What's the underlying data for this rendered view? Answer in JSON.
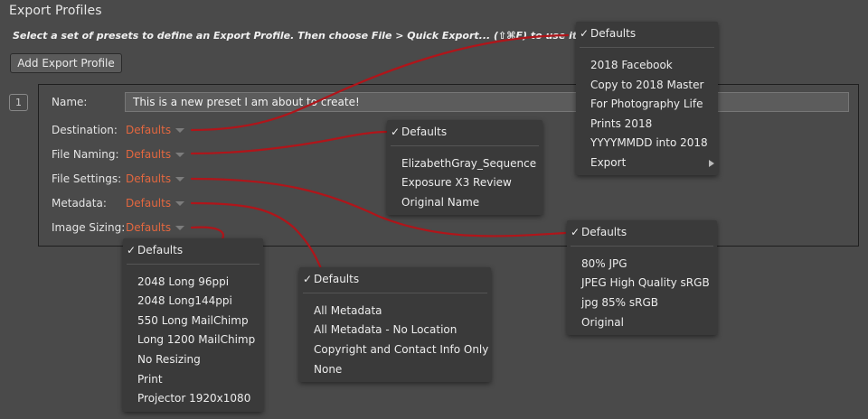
{
  "header": {
    "title": "Export Profiles",
    "instructions": "Select a set of presets to define an Export Profile. Then choose File  > Quick Export... (⇧⌘E) to use it.",
    "add_button": "Add Export Profile"
  },
  "profile": {
    "index": "1",
    "name_label": "Name:",
    "name_value": "This is a new preset I am about to create!",
    "rows": [
      {
        "label": "Destination:",
        "value": "Defaults"
      },
      {
        "label": "File Naming:",
        "value": "Defaults"
      },
      {
        "label": "File Settings:",
        "value": "Defaults"
      },
      {
        "label": "Metadata:",
        "value": "Defaults"
      },
      {
        "label": "Image Sizing:",
        "value": "Defaults"
      }
    ]
  },
  "menus": {
    "destination": {
      "selected": "Defaults",
      "items": [
        "2018 Facebook",
        "Copy to 2018 Master",
        "For Photography Life",
        "Prints 2018",
        "YYYYMMDD into 2018",
        "Export"
      ]
    },
    "file_naming": {
      "selected": "Defaults",
      "items": [
        "ElizabethGray_Sequence",
        "Exposure X3 Review",
        "Original Name"
      ]
    },
    "file_settings": {
      "selected": "Defaults",
      "items": [
        "80% JPG",
        "JPEG High Quality sRGB",
        "jpg 85% sRGB",
        "Original"
      ]
    },
    "metadata": {
      "selected": "Defaults",
      "items": [
        "All Metadata",
        "All Metadata - No Location",
        "Copyright and Contact Info Only",
        "None"
      ]
    },
    "image_sizing": {
      "selected": "Defaults",
      "items": [
        "2048 Long 96ppi",
        "2048 Long144ppi",
        "550 Long MailChimp",
        "Long 1200 MailChimp",
        "No Resizing",
        "Print",
        "Projector 1920x1080"
      ]
    }
  },
  "icons": {
    "check": "checkmark-icon",
    "caret": "caret-down-icon",
    "submenu": "chevron-right-icon"
  },
  "colors": {
    "background": "#4a4a4a",
    "accent": "#e3673f",
    "connector": "#b0151a",
    "menu_bg": "#3a3a3a"
  }
}
